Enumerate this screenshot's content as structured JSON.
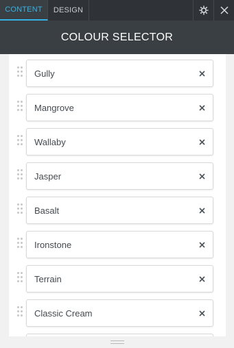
{
  "tabs": [
    {
      "label": "CONTENT",
      "active": true
    },
    {
      "label": "DESIGN",
      "active": false
    }
  ],
  "toolbar": {
    "settings_icon": "gear-icon",
    "close_icon": "close-icon"
  },
  "header": {
    "title": "COLOUR SELECTOR"
  },
  "items": [
    {
      "label": "Gully"
    },
    {
      "label": "Mangrove"
    },
    {
      "label": "Wallaby"
    },
    {
      "label": "Jasper"
    },
    {
      "label": "Basalt"
    },
    {
      "label": "Ironstone"
    },
    {
      "label": "Terrain"
    },
    {
      "label": "Classic Cream"
    }
  ],
  "colors": {
    "accent": "#36b3e6",
    "topbar": "#2f3337",
    "header": "#3a3f43"
  }
}
